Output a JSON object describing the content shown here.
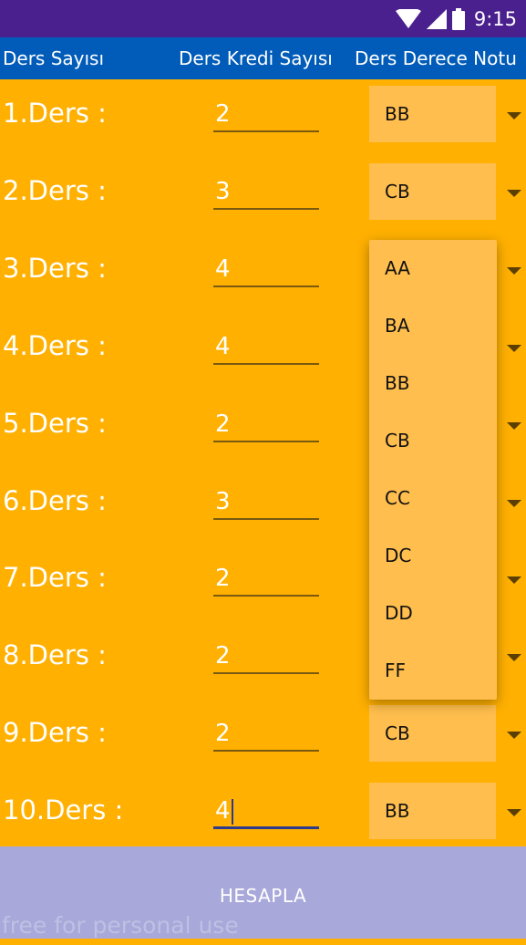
{
  "status_bar": {
    "time": "9:15"
  },
  "header": {
    "col1": "Ders Sayısı",
    "col2": "Ders Kredi Sayısı",
    "col3": "Ders Derece Notu"
  },
  "rows": [
    {
      "label": "1.Ders :",
      "credit": "2",
      "grade": "BB"
    },
    {
      "label": "2.Ders :",
      "credit": "3",
      "grade": "CB"
    },
    {
      "label": "3.Ders :",
      "credit": "4",
      "grade": ""
    },
    {
      "label": "4.Ders :",
      "credit": "4",
      "grade": ""
    },
    {
      "label": "5.Ders :",
      "credit": "2",
      "grade": ""
    },
    {
      "label": "6.Ders :",
      "credit": "3",
      "grade": ""
    },
    {
      "label": "7.Ders :",
      "credit": "2",
      "grade": ""
    },
    {
      "label": "8.Ders :",
      "credit": "2",
      "grade": ""
    },
    {
      "label": "9.Ders :",
      "credit": "2",
      "grade": "CB"
    },
    {
      "label": "10.Ders :",
      "credit": "4",
      "grade": "BB"
    }
  ],
  "dropdown_options": [
    "AA",
    "BA",
    "BB",
    "CB",
    "CC",
    "DC",
    "DD",
    "FF"
  ],
  "calculate_button": "HESAPLA",
  "watermark": "free for personal use"
}
